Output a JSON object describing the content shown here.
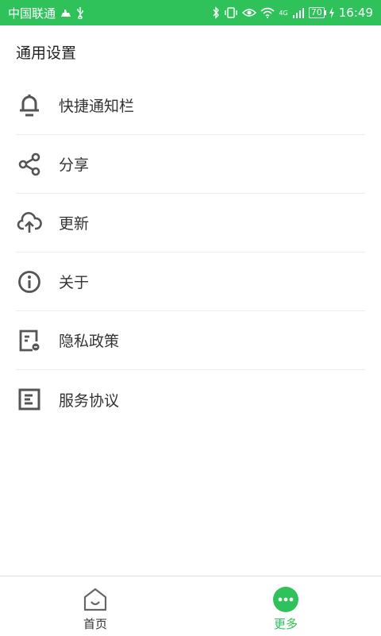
{
  "status_bar": {
    "carrier": "中国联通",
    "network": "4G",
    "battery": "70",
    "time": "16:49",
    "color": "#2fc25b"
  },
  "page": {
    "title": "通用设置"
  },
  "menu": {
    "items": [
      {
        "label": "快捷通知栏",
        "icon": "bell-icon"
      },
      {
        "label": "分享",
        "icon": "share-icon"
      },
      {
        "label": "更新",
        "icon": "cloud-upload-icon"
      },
      {
        "label": "关于",
        "icon": "info-icon"
      },
      {
        "label": "隐私政策",
        "icon": "privacy-doc-icon"
      },
      {
        "label": "服务协议",
        "icon": "agreement-doc-icon"
      }
    ]
  },
  "tab_bar": {
    "tabs": [
      {
        "label": "首页",
        "icon": "home-icon",
        "active": false
      },
      {
        "label": "更多",
        "icon": "more-icon",
        "active": true
      }
    ],
    "accent": "#2fc25b"
  }
}
